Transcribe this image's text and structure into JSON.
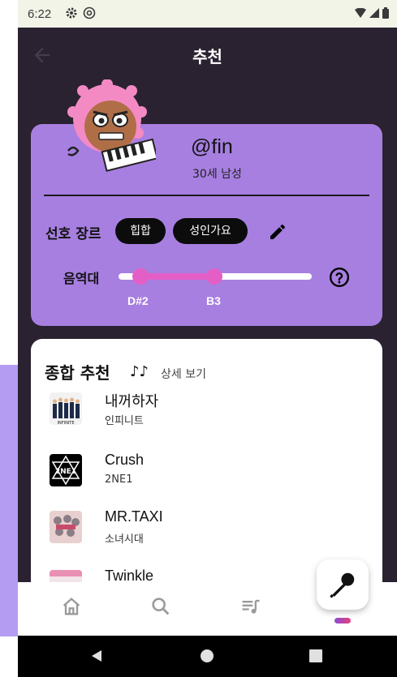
{
  "status_bar": {
    "time": "6:22",
    "icons_left": [
      "gear-icon",
      "at-sign-icon"
    ],
    "icons_right": [
      "wifi-icon",
      "signal-icon",
      "battery-icon"
    ]
  },
  "header": {
    "title": "추천",
    "back_icon": "arrow-left-icon"
  },
  "profile": {
    "username": "@fin",
    "sub": "30세 남성",
    "genre_label": "선호 장르",
    "genres": [
      "힙합",
      "성인가요"
    ],
    "edit_icon": "pencil-icon",
    "range_label": "음역대",
    "range_low": "D#2",
    "range_high": "B3",
    "help_icon": "help-circle-icon"
  },
  "recommend": {
    "title": "종합 추천",
    "note_icon": "music-notes-icon",
    "detail_link": "상세 보기",
    "songs": [
      {
        "title": "내꺼하자",
        "artist": "인피니트"
      },
      {
        "title": "Crush",
        "artist": "2NE1"
      },
      {
        "title": "MR.TAXI",
        "artist": "소녀시대"
      },
      {
        "title": "Twinkle",
        "artist": ""
      }
    ]
  },
  "fab": {
    "icon": "microphone-icon"
  },
  "bottom_nav": {
    "items": [
      "home-icon",
      "search-icon",
      "queue-music-icon",
      "profile-tab"
    ]
  },
  "colors": {
    "card_purple": "#a77fe0",
    "accent_pink": "#e35fc6",
    "background_dark": "#2a2230",
    "chip_black": "#0c0c0c"
  }
}
